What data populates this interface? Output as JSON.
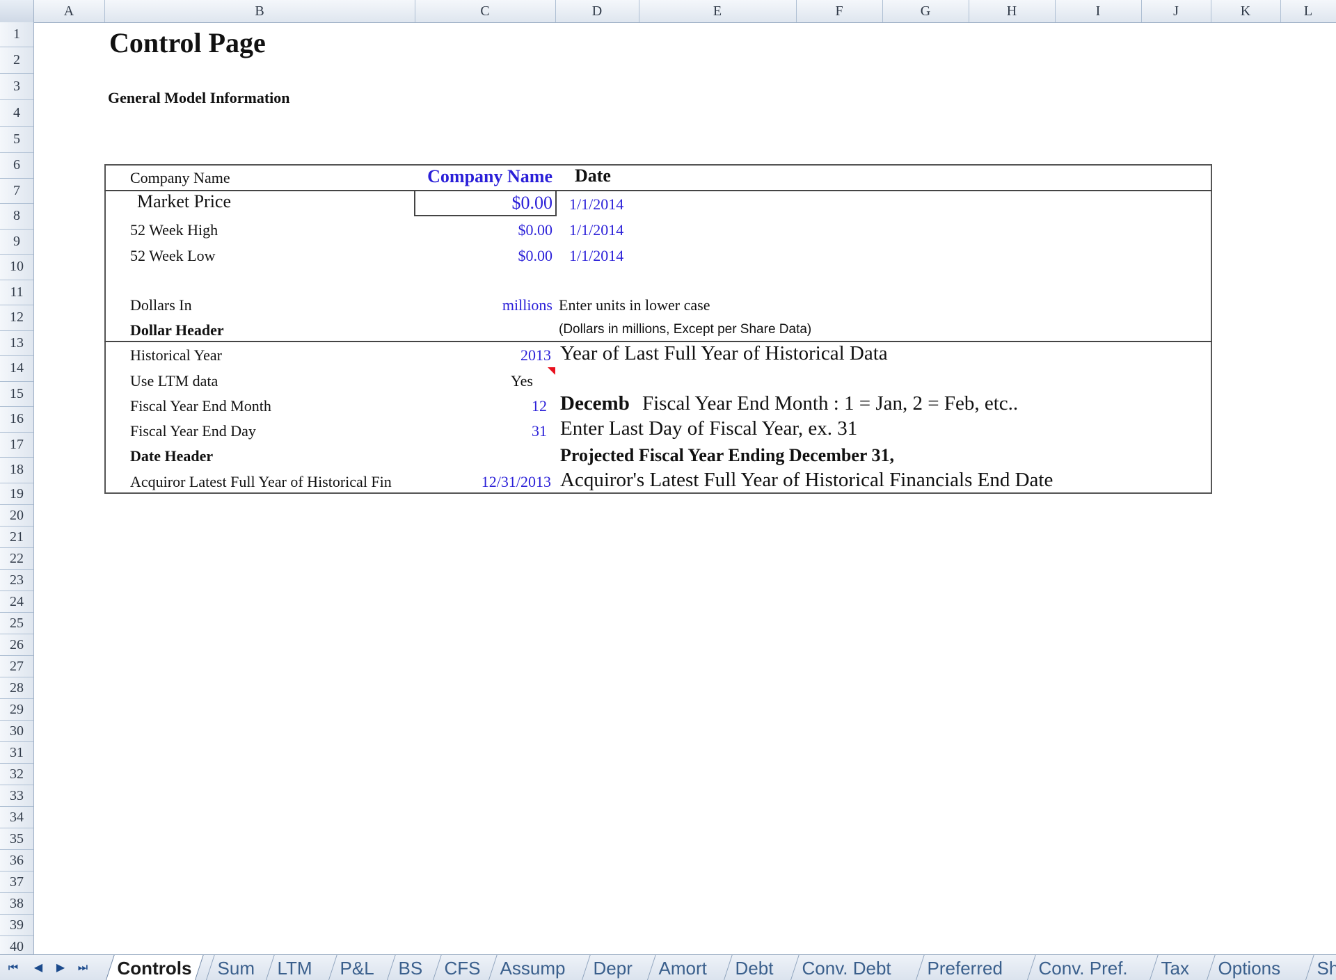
{
  "columns": [
    "A",
    "B",
    "C",
    "D",
    "E",
    "F",
    "G",
    "H",
    "I",
    "J",
    "K",
    "L"
  ],
  "rows": [
    "1",
    "2",
    "3",
    "4",
    "5",
    "6",
    "7",
    "8",
    "9",
    "10",
    "11",
    "12",
    "13",
    "14",
    "15",
    "16",
    "17",
    "18",
    "19",
    "20",
    "21",
    "22",
    "23",
    "24",
    "25",
    "26",
    "27",
    "28",
    "29",
    "30",
    "31",
    "32",
    "33",
    "34",
    "35",
    "36",
    "37",
    "38",
    "39",
    "40"
  ],
  "page": {
    "title": "Control Page",
    "section_title": "General Model Information"
  },
  "table": {
    "company_label": "Company Name",
    "company_header": "Company Name",
    "date_header": "Date",
    "market_price_label": "Market Price",
    "market_price_value": "$0.00",
    "market_price_date": "1/1/2014",
    "high_label": "52 Week High",
    "high_value": "$0.00",
    "high_date": "1/1/2014",
    "low_label": "52 Week Low",
    "low_value": "$0.00",
    "low_date": "1/1/2014",
    "dollars_in_label": "Dollars In",
    "dollars_in_value": "millions",
    "dollars_in_note": "Enter units in lower case",
    "dollar_header_label": "Dollar Header",
    "dollar_header_value": "(Dollars in millions, Except per Share Data)",
    "hist_year_label": "Historical Year",
    "hist_year_value": "2013",
    "hist_year_note": "Year of Last Full Year of Historical Data",
    "ltm_label": "Use LTM data",
    "ltm_value": "Yes",
    "fy_month_label": "Fiscal Year End Month",
    "fy_month_value": "12",
    "fy_month_name": "Decemb",
    "fy_month_note": "Fiscal Year End Month : 1 = Jan, 2 = Feb, etc..",
    "fy_day_label": "Fiscal Year End Day",
    "fy_day_value": "31",
    "fy_day_note": "Enter Last Day of Fiscal Year, ex. 31",
    "date_header_label": "Date Header",
    "date_header_value": "Projected Fiscal Year Ending December 31,",
    "acq_label": "Acquiror Latest Full Year of Historical Fin",
    "acq_value": "12/31/2013",
    "acq_note": "Acquiror's Latest Full Year of Historical Financials End Date"
  },
  "tabs": [
    "Controls",
    "Sum",
    "LTM",
    "P&L",
    "BS",
    "CFS",
    "Assump",
    "Depr",
    "Amort",
    "Debt",
    "Conv. Debt",
    "Preferred",
    "Conv. Pref.",
    "Tax",
    "Options",
    "Sh"
  ],
  "active_tab": "Controls",
  "nav_icons": [
    "first-sheet-icon",
    "prev-sheet-icon",
    "next-sheet-icon",
    "last-sheet-icon"
  ]
}
